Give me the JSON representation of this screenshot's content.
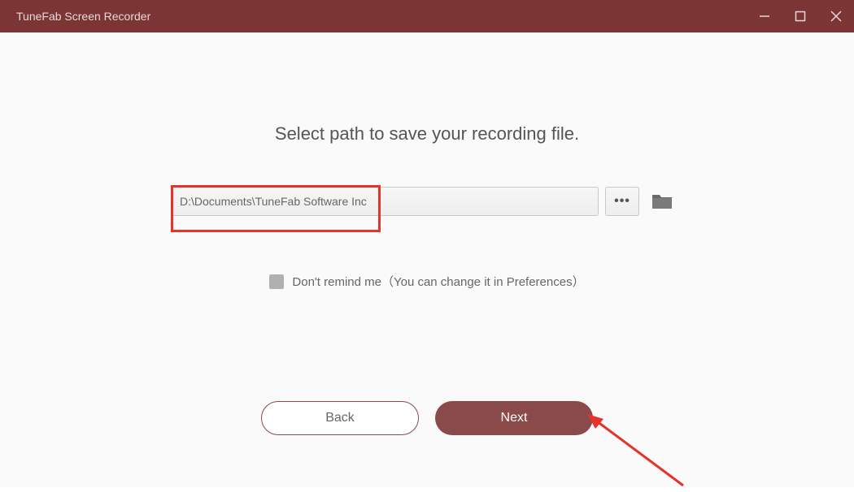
{
  "window": {
    "title": "TuneFab Screen Recorder"
  },
  "heading": "Select path to save your recording file.",
  "path": {
    "value": "D:\\Documents\\TuneFab Software Inc"
  },
  "remind": {
    "label": "Don't remind me（You can change it in Preferences）"
  },
  "buttons": {
    "back": "Back",
    "next": "Next"
  }
}
